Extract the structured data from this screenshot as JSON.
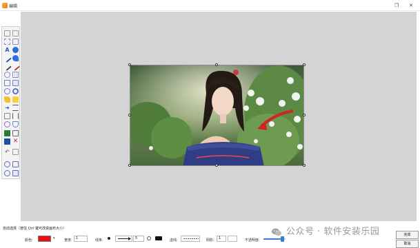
{
  "window": {
    "title": "编辑",
    "restore_glyph": "❐",
    "close_glyph": "✕",
    "accent_color": "#e8a02a"
  },
  "left_toolbar": {
    "tools": [
      "pointer-icon",
      "undo-icon",
      "select-rect-icon",
      "copy-icon",
      "text-icon",
      "info-icon",
      "pencil-icon",
      "blue-pen-icon",
      "brush-icon",
      "pen-icon",
      "lasso-icon",
      "grid-icon",
      "rectangle-icon",
      "table-icon",
      "circle-icon",
      "settings-icon",
      "highlighter-icon",
      "yellow-marker-icon",
      "arrow-icon",
      "menu-icon",
      "text-box-icon",
      "numbered-list-icon",
      "bubble-icon",
      "shield-icon",
      "image-icon",
      "crop-icon",
      "layer-icon",
      "delete-icon",
      "rotate-icon",
      "flip-icon",
      "zoom-in-icon",
      "expand-icon",
      "zoom-out-icon",
      "fit-icon"
    ]
  },
  "image": {
    "subject": "photo of young woman in blue off-shoulder top in a garden with white flowers",
    "arrow_color": "#d42222"
  },
  "bottom_bar": {
    "hint": "自动选择（按住 Ctrl 键可改变画布大小）",
    "color_label": "颜色:",
    "color_value": "#ee1111",
    "width_label": "宽度:",
    "width_value": "1",
    "line_label": "线条:",
    "line_size_value": "5",
    "border_label": "虚线:",
    "shadow_label": "阴影:",
    "shadow_value": "1",
    "opacity_label": "不透明度:",
    "opacity_percent": 85,
    "ok_label": "完成",
    "cancel_label": "取消"
  },
  "watermark": {
    "text": "公众号 · 软件安装乐园"
  }
}
